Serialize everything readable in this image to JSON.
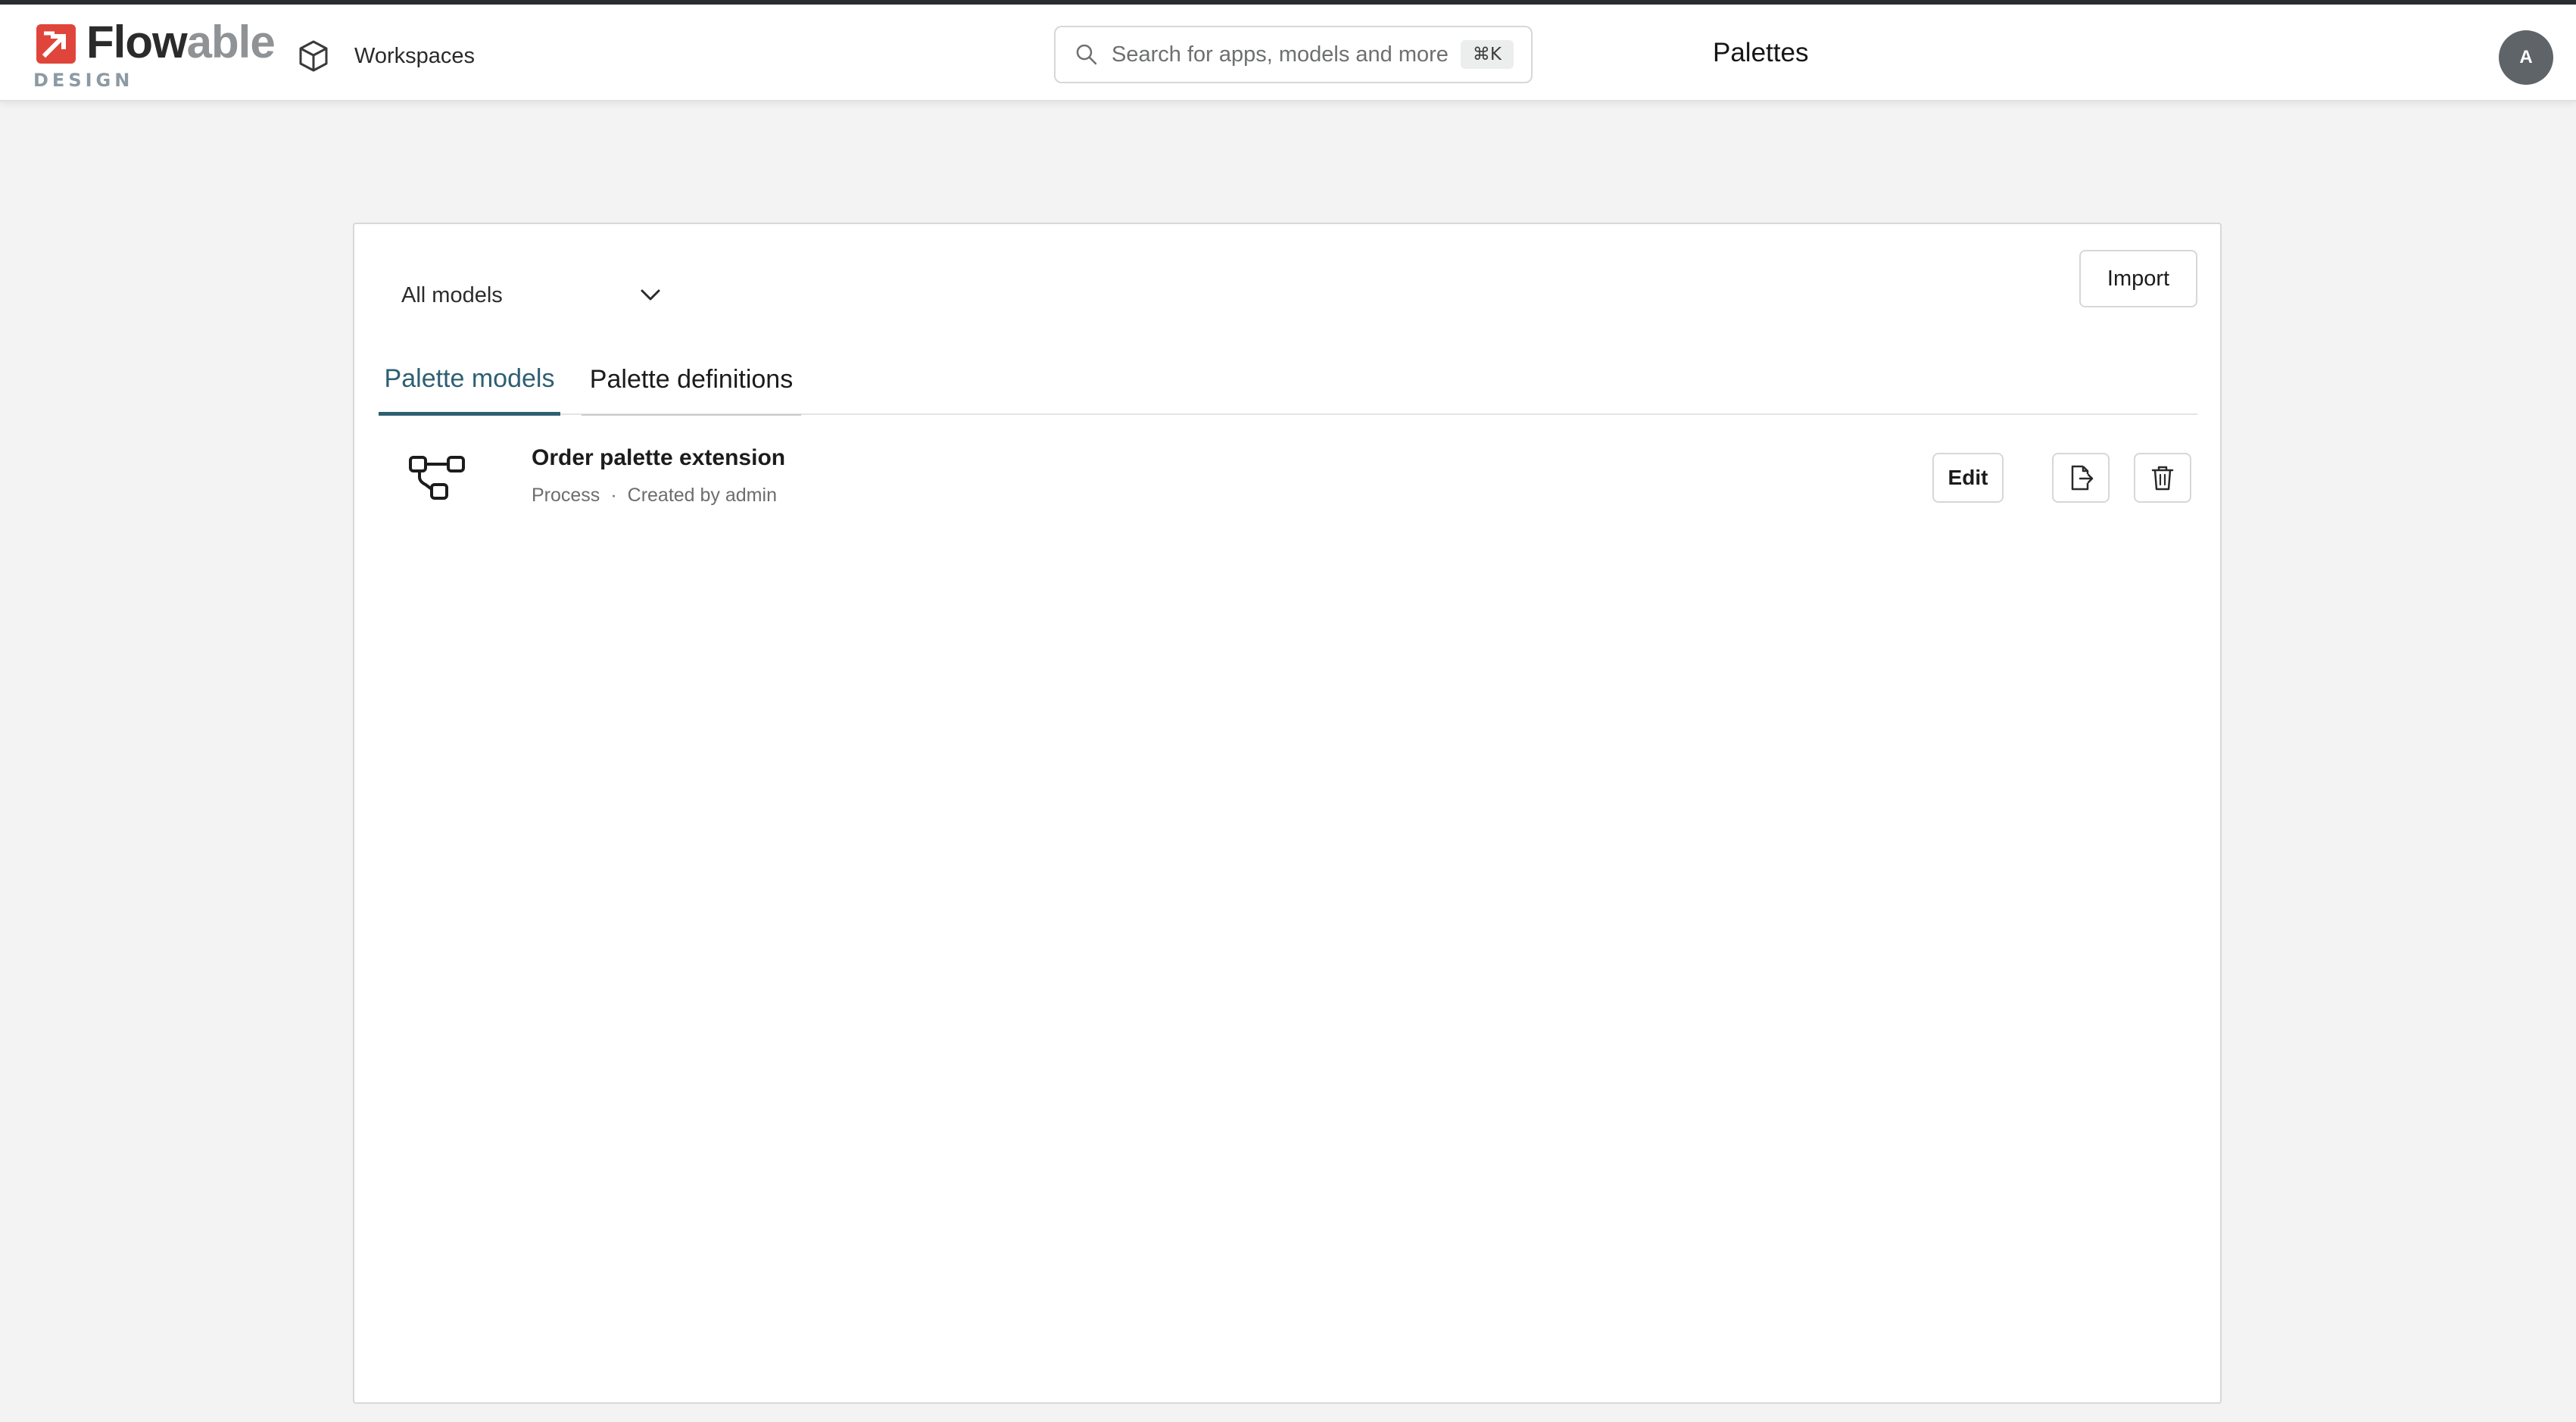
{
  "header": {
    "logo": {
      "word_main": "Flow",
      "word_accent": "able",
      "subtitle": "DESIGN",
      "brand_color": "#e0453b"
    },
    "workspaces_label": "Workspaces",
    "search": {
      "placeholder": "Search for apps, models and more",
      "shortcut": "⌘K"
    },
    "page_title": "Palettes",
    "avatar_initial": "A"
  },
  "toolbar": {
    "filter_selected": "All models",
    "import_label": "Import"
  },
  "tabs": [
    {
      "label": "Palette models",
      "active": true
    },
    {
      "label": "Palette definitions",
      "active": false
    }
  ],
  "models": [
    {
      "title": "Order palette extension",
      "type": "Process",
      "separator": "·",
      "created": "Created by admin",
      "edit_label": "Edit"
    }
  ],
  "colors": {
    "accent": "#2e5f72",
    "background": "#f2f3f2",
    "card": "#ffffff",
    "avatar": "#5f6468"
  }
}
